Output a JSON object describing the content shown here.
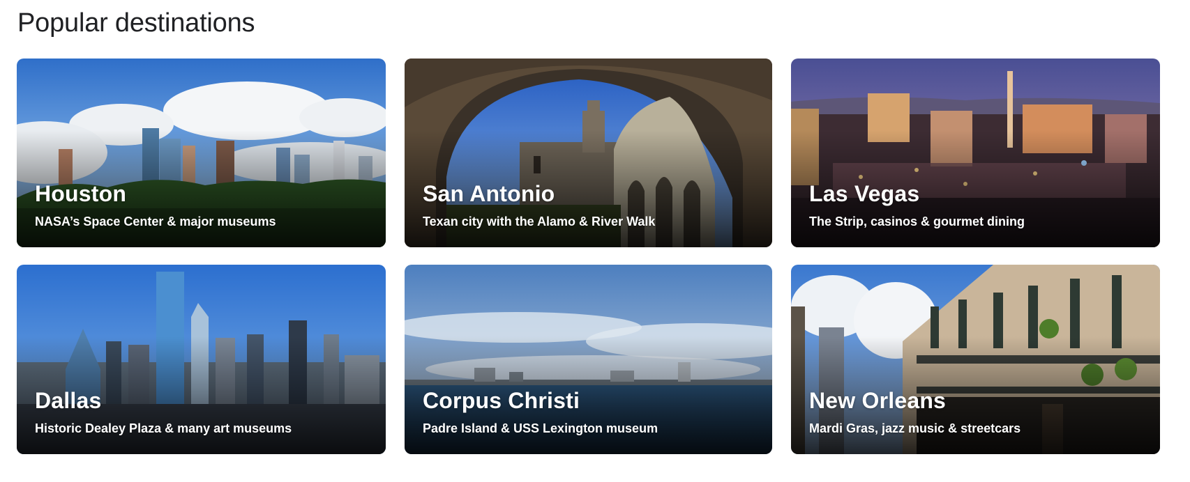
{
  "section": {
    "title": "Popular destinations"
  },
  "destinations": [
    {
      "name": "Houston",
      "description": "NASA’s Space Center & major museums"
    },
    {
      "name": "San Antonio",
      "description": "Texan city with the Alamo & River Walk"
    },
    {
      "name": "Las Vegas",
      "description": "The Strip, casinos & gourmet dining"
    },
    {
      "name": "Dallas",
      "description": "Historic Dealey Plaza & many art museums"
    },
    {
      "name": "Corpus Christi",
      "description": "Padre Island & USS Lexington museum"
    },
    {
      "name": "New Orleans",
      "description": "Mardi Gras, jazz music & streetcars"
    }
  ]
}
